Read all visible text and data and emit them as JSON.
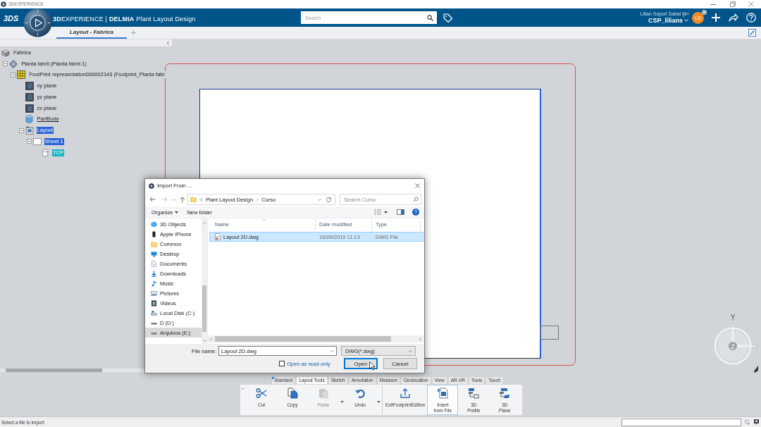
{
  "window": {
    "title": "3DEXPERIENCE"
  },
  "header": {
    "logo": "3DS",
    "title": "**3D**EXPERIENCE | **DELMIA** Plant Layout Design",
    "search_placeholder": "Search",
    "user_name": "Lilian Sayuri Sakai Ijiri",
    "credentials": "CSP_lilians",
    "initials": "LS"
  },
  "tabs": [
    {
      "label": "Layout - Fabrica",
      "selected": true
    }
  ],
  "tree": [
    {
      "label": "Fabrica",
      "kind": "product",
      "selected": false,
      "highlighted": false,
      "in_work": false,
      "children": [
        {
          "label": "Planta fabril (Planta fabril.1)",
          "kind": "part",
          "expanded": true,
          "selected": false,
          "highlighted": false,
          "in_work": false,
          "children": [
            {
              "label": "FootPrint representation000002143 (Footprint_Planta fabr",
              "kind": "footprint",
              "expanded": true,
              "selected": false,
              "highlighted": false,
              "in_work": false,
              "children": [
                {
                  "label": "xy plane",
                  "kind": "plane",
                  "selected": false,
                  "highlighted": false,
                  "in_work": false
                },
                {
                  "label": "yz plane",
                  "kind": "plane",
                  "selected": false,
                  "highlighted": false,
                  "in_work": false
                },
                {
                  "label": "zx plane",
                  "kind": "plane",
                  "selected": false,
                  "highlighted": false,
                  "in_work": false
                },
                {
                  "label": "PartBody",
                  "kind": "body",
                  "selected": false,
                  "highlighted": false,
                  "in_work": true
                },
                {
                  "label": "Layout",
                  "kind": "layout",
                  "expanded": true,
                  "selected": true,
                  "highlighted": false,
                  "in_work": false,
                  "children": [
                    {
                      "label": "Sheet 1",
                      "kind": "sheet",
                      "expanded": true,
                      "selected": true,
                      "highlighted": false,
                      "in_work": false,
                      "children": [
                        {
                          "label": "TCP",
                          "kind": "point",
                          "selected": false,
                          "highlighted": true,
                          "in_work": false
                        }
                      ]
                    }
                  ]
                }
              ]
            }
          ]
        }
      ]
    }
  ],
  "compass": {
    "y_label": "Y",
    "z_label": "Z"
  },
  "dialog": {
    "title": "Import From ...",
    "path": [
      "Plant Layout Design",
      "Curso"
    ],
    "search_placeholder": "Search Curso",
    "commands": [
      {
        "label": "Organize",
        "kind": "menu"
      },
      {
        "label": "New folder",
        "kind": "button"
      }
    ],
    "nav": [
      {
        "label": "3D Objects",
        "kind": "cube",
        "selected": false
      },
      {
        "label": "Apple iPhone",
        "kind": "phone",
        "selected": false
      },
      {
        "label": "Common",
        "kind": "folder",
        "selected": false
      },
      {
        "label": "Desktop",
        "kind": "desktop",
        "selected": false
      },
      {
        "label": "Documents",
        "kind": "document",
        "selected": false
      },
      {
        "label": "Downloads",
        "kind": "download",
        "selected": false
      },
      {
        "label": "Music",
        "kind": "music",
        "selected": false
      },
      {
        "label": "Pictures",
        "kind": "picture",
        "selected": false
      },
      {
        "label": "Videos",
        "kind": "video",
        "selected": false
      },
      {
        "label": "Local Disk (C:)",
        "kind": "system-drive",
        "selected": false
      },
      {
        "label": "D (D:)",
        "kind": "drive",
        "selected": false
      },
      {
        "label": "Arquivos (E:)",
        "kind": "drive",
        "selected": true
      }
    ],
    "columns": [
      "Name",
      "Date modified",
      "Type"
    ],
    "files": [
      {
        "name": "Layout 2D.dwg",
        "date": "16/09/2019 11:13",
        "type": "DWG File",
        "selected": true
      }
    ],
    "file_name_label": "File name:",
    "file_name": "Layout 2D.dwg",
    "file_type": "DWG(*.dwg)",
    "read_only": {
      "label": "Open as read-only",
      "checked": false
    },
    "buttons": [
      {
        "label": "Open",
        "default": true
      },
      {
        "label": "Cancel",
        "default": false
      }
    ]
  },
  "action_bar": {
    "tabs": [
      {
        "label": "Standard",
        "selected": false,
        "pinned": true
      },
      {
        "label": "Layout Tools",
        "selected": true,
        "pinned": false
      },
      {
        "label": "Sketch",
        "selected": false,
        "pinned": false
      },
      {
        "label": "Annotation",
        "selected": false,
        "pinned": false
      },
      {
        "label": "Measure",
        "selected": false,
        "pinned": false
      },
      {
        "label": "Geolocation",
        "selected": false,
        "pinned": false
      },
      {
        "label": "View",
        "selected": false,
        "pinned": false
      },
      {
        "label": "AR-VR",
        "selected": false,
        "pinned": false
      },
      {
        "label": "Tools",
        "selected": false,
        "pinned": false
      },
      {
        "label": "Touch",
        "selected": false,
        "pinned": false
      }
    ],
    "groups": [
      {
        "commands": [
          {
            "label": "Cut",
            "kind": "cut",
            "disabled": false,
            "active": false,
            "has_menu": false
          },
          {
            "label": "Copy",
            "kind": "copy",
            "disabled": false,
            "active": false,
            "has_menu": false
          },
          {
            "label": "Paste",
            "kind": "paste",
            "disabled": true,
            "active": false,
            "has_menu": true
          },
          {
            "label": "Undo",
            "kind": "undo",
            "disabled": false,
            "active": false,
            "has_menu": true
          }
        ]
      },
      {
        "commands": [
          {
            "label": "ExitFootprintEdition",
            "kind": "exit",
            "disabled": false,
            "active": false,
            "has_menu": false
          },
          {
            "label": "Insert\nfrom File",
            "kind": "insert",
            "disabled": false,
            "active": true,
            "has_menu": false
          },
          {
            "label": "3D\nProfile",
            "kind": "profile",
            "disabled": false,
            "active": false,
            "has_menu": false
          },
          {
            "label": "3D\nPlane",
            "kind": "plane",
            "disabled": false,
            "active": false,
            "has_menu": false
          }
        ]
      }
    ]
  },
  "status_bar": {
    "message": "Select a file to import"
  }
}
